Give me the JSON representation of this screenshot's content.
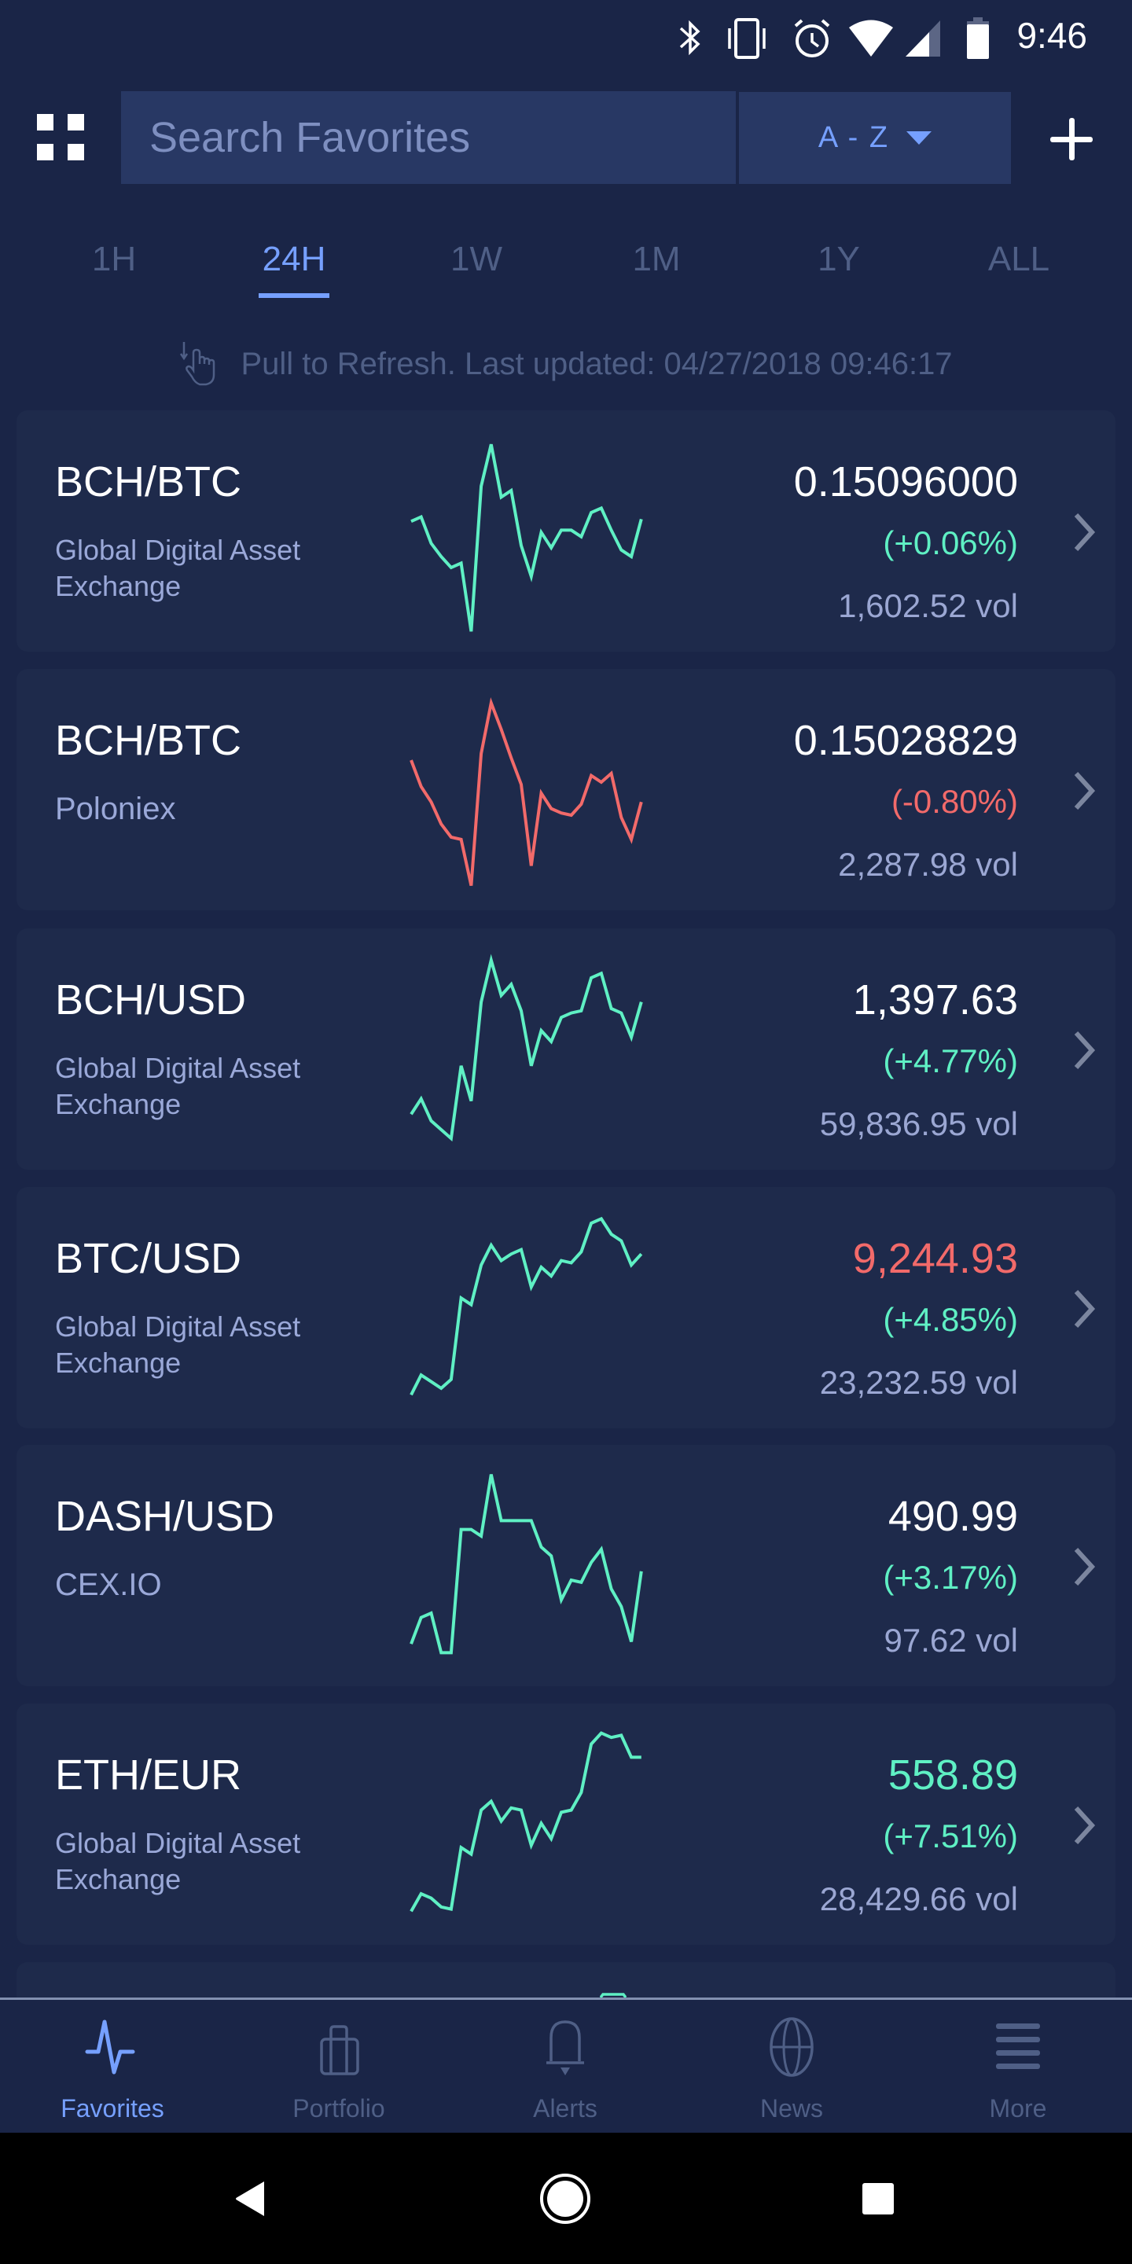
{
  "status_bar": {
    "time": "9:46",
    "icons": [
      "bluetooth-icon",
      "vibrate-icon",
      "alarm-icon",
      "wifi-icon",
      "signal-icon",
      "battery-icon"
    ]
  },
  "toolbar": {
    "menu_icon": "grid-icon",
    "search_placeholder": "Search Favorites",
    "search_value": "",
    "sort_label": "A - Z",
    "add_icon": "plus-icon"
  },
  "time_tabs": [
    {
      "label": "1H",
      "active": false
    },
    {
      "label": "24H",
      "active": true
    },
    {
      "label": "1W",
      "active": false
    },
    {
      "label": "1M",
      "active": false
    },
    {
      "label": "1Y",
      "active": false
    },
    {
      "label": "ALL",
      "active": false
    }
  ],
  "refresh": {
    "icon": "pull-refresh-hand-icon",
    "text": "Pull to Refresh. Last updated: 04/27/2018 09:46:17"
  },
  "colors": {
    "accent": "#76a0ff",
    "up": "#5ff0c4",
    "down": "#f26a6a",
    "neutral_price": "#ffffff",
    "muted": "#4f5f86",
    "card_bg": "#1e2a4b",
    "page_bg": "#1a2547"
  },
  "favorites": [
    {
      "pair": "BCH/BTC",
      "exchange": "Global Digital Asset Exchange",
      "price": "0.15096000",
      "price_trend": "neutral",
      "change": "(+0.06%)",
      "change_trend": "up",
      "volume": "1,602.52 vol",
      "spark_trend": "up",
      "sparkline": [
        56,
        58,
        46,
        40,
        35,
        37,
        6,
        72,
        91,
        67,
        70,
        45,
        31,
        51,
        44,
        52,
        52,
        49,
        60,
        62,
        52,
        43,
        40,
        57
      ]
    },
    {
      "pair": "BCH/BTC",
      "exchange": "Poloniex",
      "price": "0.15028829",
      "price_trend": "neutral",
      "change": "(-0.80%)",
      "change_trend": "down",
      "volume": "2,287.98 vol",
      "spark_trend": "down",
      "sparkline": [
        65,
        53,
        46,
        36,
        30,
        29,
        8,
        68,
        91,
        79,
        66,
        54,
        17,
        50,
        43,
        41,
        40,
        45,
        58,
        55,
        59,
        39,
        29,
        46
      ]
    },
    {
      "pair": "BCH/USD",
      "exchange": "Global Digital Asset Exchange",
      "price": "1,397.63",
      "price_trend": "neutral",
      "change": "(+4.77%)",
      "change_trend": "up",
      "volume": "59,836.95 vol",
      "spark_trend": "up",
      "sparkline": [
        22,
        29,
        19,
        15,
        11,
        44,
        28,
        73,
        92,
        76,
        81,
        69,
        44,
        60,
        55,
        66,
        68,
        69,
        84,
        86,
        70,
        68,
        57,
        73
      ]
    },
    {
      "pair": "BTC/USD",
      "exchange": "Global Digital Asset Exchange",
      "price": "9,244.93",
      "price_trend": "down",
      "change": "(+4.85%)",
      "change_trend": "up",
      "volume": "23,232.59 vol",
      "spark_trend": "up",
      "sparkline": [
        12,
        21,
        18,
        15,
        19,
        56,
        53,
        71,
        80,
        73,
        76,
        78,
        61,
        70,
        66,
        73,
        72,
        77,
        90,
        92,
        85,
        82,
        71,
        76
      ]
    },
    {
      "pair": "DASH/USD",
      "exchange": "CEX.IO",
      "price": "490.99",
      "price_trend": "neutral",
      "change": "(+3.17%)",
      "change_trend": "up",
      "volume": "97.62 vol",
      "spark_trend": "up",
      "sparkline": [
        16,
        28,
        30,
        12,
        12,
        68,
        68,
        65,
        93,
        72,
        72,
        72,
        72,
        60,
        56,
        36,
        45,
        44,
        53,
        59,
        41,
        33,
        17,
        49
      ]
    },
    {
      "pair": "ETH/EUR",
      "exchange": "Global Digital Asset Exchange",
      "price": "558.89",
      "price_trend": "up",
      "change": "(+7.51%)",
      "change_trend": "up",
      "volume": "28,429.66 vol",
      "spark_trend": "up",
      "sparkline": [
        12,
        20,
        18,
        14,
        13,
        41,
        38,
        58,
        62,
        53,
        59,
        58,
        42,
        52,
        45,
        57,
        58,
        66,
        88,
        93,
        91,
        92,
        82,
        82
      ]
    }
  ],
  "bottom_nav": [
    {
      "label": "Favorites",
      "icon": "pulse-icon",
      "active": true
    },
    {
      "label": "Portfolio",
      "icon": "briefcase-icon",
      "active": false
    },
    {
      "label": "Alerts",
      "icon": "bell-icon",
      "active": false
    },
    {
      "label": "News",
      "icon": "globe-icon",
      "active": false
    },
    {
      "label": "More",
      "icon": "menu-icon",
      "active": false
    }
  ],
  "system_nav": [
    "back-icon",
    "home-icon",
    "recents-icon"
  ]
}
